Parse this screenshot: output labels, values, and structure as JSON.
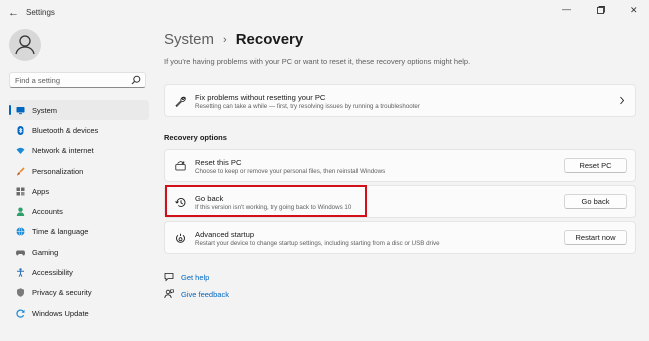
{
  "window": {
    "title": "Settings"
  },
  "search": {
    "placeholder": "Find a setting"
  },
  "nav": [
    {
      "label": "System",
      "icon": "monitor-icon",
      "active": true
    },
    {
      "label": "Bluetooth & devices",
      "icon": "bluetooth-icon"
    },
    {
      "label": "Network & internet",
      "icon": "wifi-icon"
    },
    {
      "label": "Personalization",
      "icon": "brush-icon"
    },
    {
      "label": "Apps",
      "icon": "apps-icon"
    },
    {
      "label": "Accounts",
      "icon": "person-icon"
    },
    {
      "label": "Time & language",
      "icon": "globe-icon"
    },
    {
      "label": "Gaming",
      "icon": "gamepad-icon"
    },
    {
      "label": "Accessibility",
      "icon": "accessibility-icon"
    },
    {
      "label": "Privacy & security",
      "icon": "shield-icon"
    },
    {
      "label": "Windows Update",
      "icon": "update-icon"
    }
  ],
  "breadcrumb": {
    "parent": "System",
    "separator": "›",
    "current": "Recovery"
  },
  "intro": "If you're having problems with your PC or want to reset it, these recovery options might help.",
  "fix": {
    "title": "Fix problems without resetting your PC",
    "desc": "Resetting can take a while — first, try resolving issues by running a troubleshooter"
  },
  "recovery_options_label": "Recovery options",
  "options": {
    "reset": {
      "title": "Reset this PC",
      "desc": "Choose to keep or remove your personal files, then reinstall Windows",
      "button": "Reset PC"
    },
    "goback": {
      "title": "Go back",
      "desc": "If this version isn't working, try going back to Windows 10",
      "button": "Go back"
    },
    "advanced": {
      "title": "Advanced startup",
      "desc": "Restart your device to change startup settings, including starting from a disc or USB drive",
      "button": "Restart now"
    }
  },
  "links": {
    "help": "Get help",
    "feedback": "Give feedback"
  },
  "colors": {
    "accent": "#0067c0",
    "highlight": "#d30f1a",
    "background": "#f3f3f3"
  }
}
